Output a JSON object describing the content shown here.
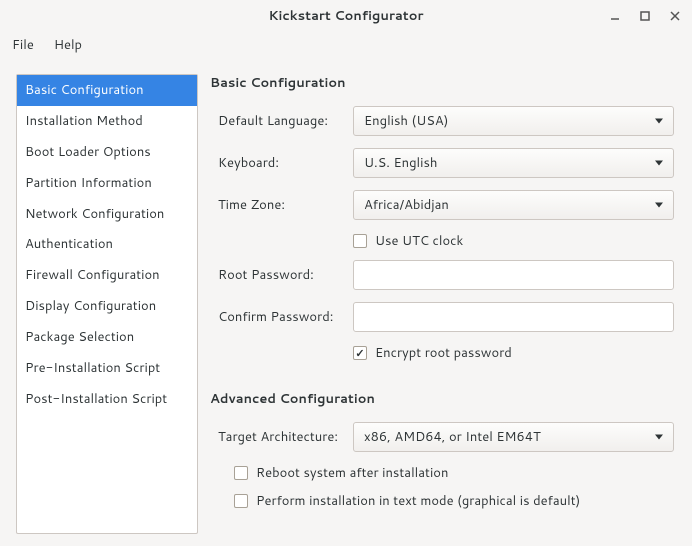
{
  "window": {
    "title": "Kickstart Configurator"
  },
  "menubar": {
    "file": "File",
    "help": "Help"
  },
  "sidebar": {
    "items": [
      "Basic Configuration",
      "Installation Method",
      "Boot Loader Options",
      "Partition Information",
      "Network Configuration",
      "Authentication",
      "Firewall Configuration",
      "Display Configuration",
      "Package Selection",
      "Pre-Installation Script",
      "Post-Installation Script"
    ],
    "selected_index": 0
  },
  "basic": {
    "heading": "Basic Configuration",
    "language_label": "Default Language:",
    "language_value": "English (USA)",
    "keyboard_label": "Keyboard:",
    "keyboard_value": "U.S. English",
    "timezone_label": "Time Zone:",
    "timezone_value": "Africa/Abidjan",
    "utc_label": "Use UTC clock",
    "utc_checked": false,
    "rootpw_label": "Root Password:",
    "rootpw_value": "",
    "confirmpw_label": "Confirm Password:",
    "confirmpw_value": "",
    "encrypt_label": "Encrypt root password",
    "encrypt_checked": true
  },
  "advanced": {
    "heading": "Advanced Configuration",
    "arch_label": "Target Architecture:",
    "arch_value": "x86, AMD64, or Intel EM64T",
    "reboot_label": "Reboot system after installation",
    "reboot_checked": false,
    "textmode_label": "Perform installation in text mode (graphical is default)",
    "textmode_checked": false
  }
}
